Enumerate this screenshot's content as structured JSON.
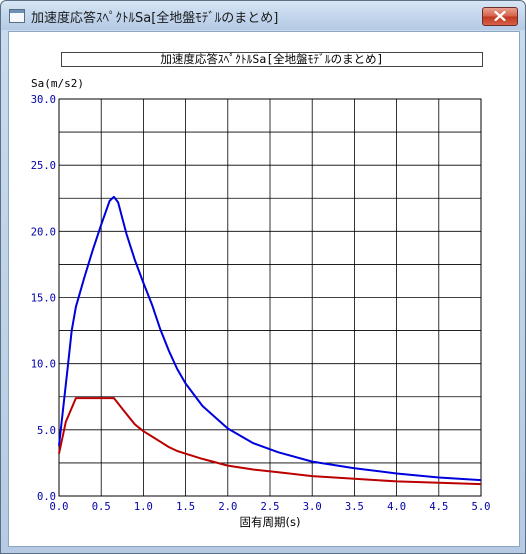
{
  "window": {
    "title": "加速度応答ｽﾍﾟｸﾄﾙSa[全地盤ﾓﾃﾞﾙのまとめ]"
  },
  "chart_data": {
    "type": "line",
    "title": "加速度応答ｽﾍﾟｸﾄﾙSa[全地盤ﾓﾃﾞﾙのまとめ]",
    "ylabel": "Sa(m/s2)",
    "xlabel": "固有周期(s)",
    "xlim": [
      0.0,
      5.0
    ],
    "ylim": [
      0.0,
      30.0
    ],
    "xticks": [
      "0.0",
      "0.5",
      "1.0",
      "1.5",
      "2.0",
      "2.5",
      "3.0",
      "3.5",
      "4.0",
      "4.5",
      "5.0"
    ],
    "yticks": [
      "0.0",
      "5.0",
      "10.0",
      "15.0",
      "20.0",
      "25.0",
      "30.0"
    ],
    "grid": true,
    "series": [
      {
        "color": "#0000dd",
        "x": [
          0.0,
          0.1,
          0.15,
          0.2,
          0.3,
          0.4,
          0.5,
          0.6,
          0.65,
          0.7,
          0.8,
          0.9,
          1.0,
          1.1,
          1.2,
          1.3,
          1.4,
          1.5,
          1.7,
          2.0,
          2.3,
          2.6,
          3.0,
          3.5,
          4.0,
          4.5,
          5.0
        ],
        "y": [
          3.8,
          9.5,
          12.5,
          14.3,
          16.5,
          18.6,
          20.5,
          22.3,
          22.6,
          22.2,
          19.8,
          17.8,
          16.1,
          14.5,
          12.6,
          11.0,
          9.6,
          8.5,
          6.8,
          5.1,
          4.0,
          3.3,
          2.6,
          2.1,
          1.7,
          1.4,
          1.2
        ]
      },
      {
        "color": "#bb0000",
        "x": [
          0.0,
          0.08,
          0.2,
          0.3,
          0.4,
          0.5,
          0.6,
          0.65,
          0.7,
          0.75,
          0.8,
          0.9,
          1.0,
          1.1,
          1.2,
          1.3,
          1.4,
          1.5,
          1.7,
          2.0,
          2.3,
          2.6,
          3.0,
          3.5,
          4.0,
          4.5,
          5.0
        ],
        "y": [
          3.2,
          5.6,
          7.4,
          7.4,
          7.4,
          7.4,
          7.4,
          7.4,
          7.0,
          6.6,
          6.2,
          5.4,
          4.9,
          4.5,
          4.1,
          3.7,
          3.4,
          3.2,
          2.8,
          2.3,
          2.0,
          1.8,
          1.5,
          1.3,
          1.1,
          1.0,
          0.9
        ]
      }
    ]
  }
}
